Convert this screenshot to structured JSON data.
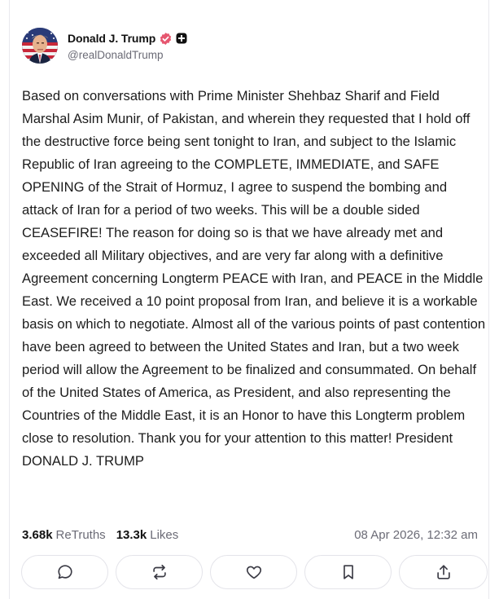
{
  "author": {
    "display_name": "Donald J. Trump",
    "handle": "@realDonaldTrump",
    "avatar_icon": "avatar-flag-portrait",
    "verified_icon": "verified-badge-icon",
    "extra_icon": "plus-badge-icon"
  },
  "post": {
    "text": "Based on conversations with Prime Minister Shehbaz Sharif and Field Marshal Asim Munir, of Pakistan, and wherein they requested that I hold off the destructive force being sent tonight to Iran, and subject to the Islamic Republic of Iran agreeing to the COMPLETE, IMMEDIATE, and SAFE OPENING of the Strait of Hormuz, I agree to suspend the bombing and attack of Iran for a period of two weeks. This will be a double sided CEASEFIRE! The reason for doing so is that we have already met and exceeded all Military objectives, and are very far along with a definitive Agreement concerning Longterm PEACE with Iran, and PEACE in the Middle East. We received a 10 point proposal from Iran, and believe it is a workable basis on which to negotiate. Almost all of the various points of past contention have been agreed to between the United States and Iran, but a two week period will allow the Agreement to be finalized and consummated. On behalf of the United States of America, as President, and also representing the Countries of the Middle East, it is an Honor to have this Longterm problem close to resolution. Thank you for your attention to this matter! President DONALD J. TRUMP"
  },
  "stats": {
    "retruths_count": "3.68k",
    "retruths_label": "ReTruths",
    "likes_count": "13.3k",
    "likes_label": "Likes",
    "timestamp": "08 Apr 2026, 12:32 am"
  },
  "actions": [
    {
      "name": "reply",
      "icon": "chat-bubble-icon"
    },
    {
      "name": "retruth",
      "icon": "repost-icon"
    },
    {
      "name": "like",
      "icon": "heart-icon"
    },
    {
      "name": "bookmark",
      "icon": "bookmark-icon"
    },
    {
      "name": "share",
      "icon": "share-upload-icon"
    }
  ],
  "colors": {
    "verified": "#e6566f",
    "text": "#1c1c1c",
    "muted": "#6b6b76",
    "border": "#e4e4ea",
    "icon": "#3a3a44"
  }
}
